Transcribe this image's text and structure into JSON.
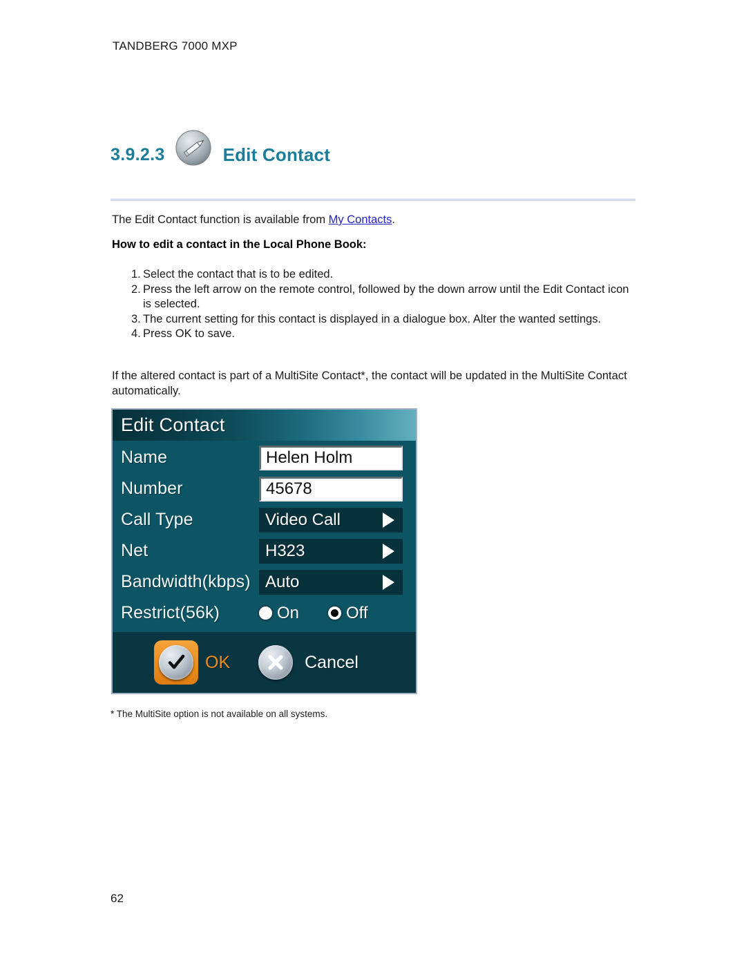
{
  "document": {
    "running_header": "TANDBERG 7000 MXP",
    "page_number": "62"
  },
  "section": {
    "number": "3.9.2.3",
    "title": "Edit Contact",
    "icon": "pencil-edit-icon",
    "heading_color": "#1b7c9c"
  },
  "content": {
    "intro_prefix": "The Edit Contact function is available from ",
    "intro_link": "My Contacts",
    "intro_suffix": ".",
    "link_color": "#2222cc",
    "subheading": "How to edit a contact in the Local Phone Book:",
    "steps": [
      {
        "num": "1.",
        "text": "Select the contact that is to be edited."
      },
      {
        "num": "2.",
        "text": "Press the left arrow on the remote control, followed by the down arrow until the Edit Contact icon is selected."
      },
      {
        "num": "3.",
        "text": "The current setting for this contact is displayed in a dialogue box. Alter the wanted settings."
      },
      {
        "num": "4.",
        "text": "Press OK to save."
      }
    ],
    "paragraph": "If the altered contact is part of a MultiSite Contact*, the contact will be updated in the MultiSite Contact automatically.",
    "footnote": "* The MultiSite option is not available on all systems."
  },
  "dialog": {
    "title": "Edit Contact",
    "colors": {
      "body": "#0d5565",
      "button_bar": "#0a3642",
      "select_field": "#07323c",
      "accent_orange": "#f08c1a"
    },
    "fields": [
      {
        "label": "Name",
        "type": "text",
        "value": "Helen Holm"
      },
      {
        "label": "Number",
        "type": "text",
        "value": "45678"
      },
      {
        "label": "Call Type",
        "type": "select",
        "value": "Video Call"
      },
      {
        "label": "Net",
        "type": "select",
        "value": "H323"
      },
      {
        "label": "Bandwidth(kbps)",
        "type": "select",
        "value": "Auto"
      }
    ],
    "restrict": {
      "label": "Restrict(56k)",
      "options": [
        {
          "label": "On",
          "selected": false
        },
        {
          "label": "Off",
          "selected": true
        }
      ]
    },
    "buttons": [
      {
        "label": "OK",
        "icon": "checkmark-icon",
        "selected": true
      },
      {
        "label": "Cancel",
        "icon": "close-x-icon",
        "selected": false
      }
    ]
  }
}
